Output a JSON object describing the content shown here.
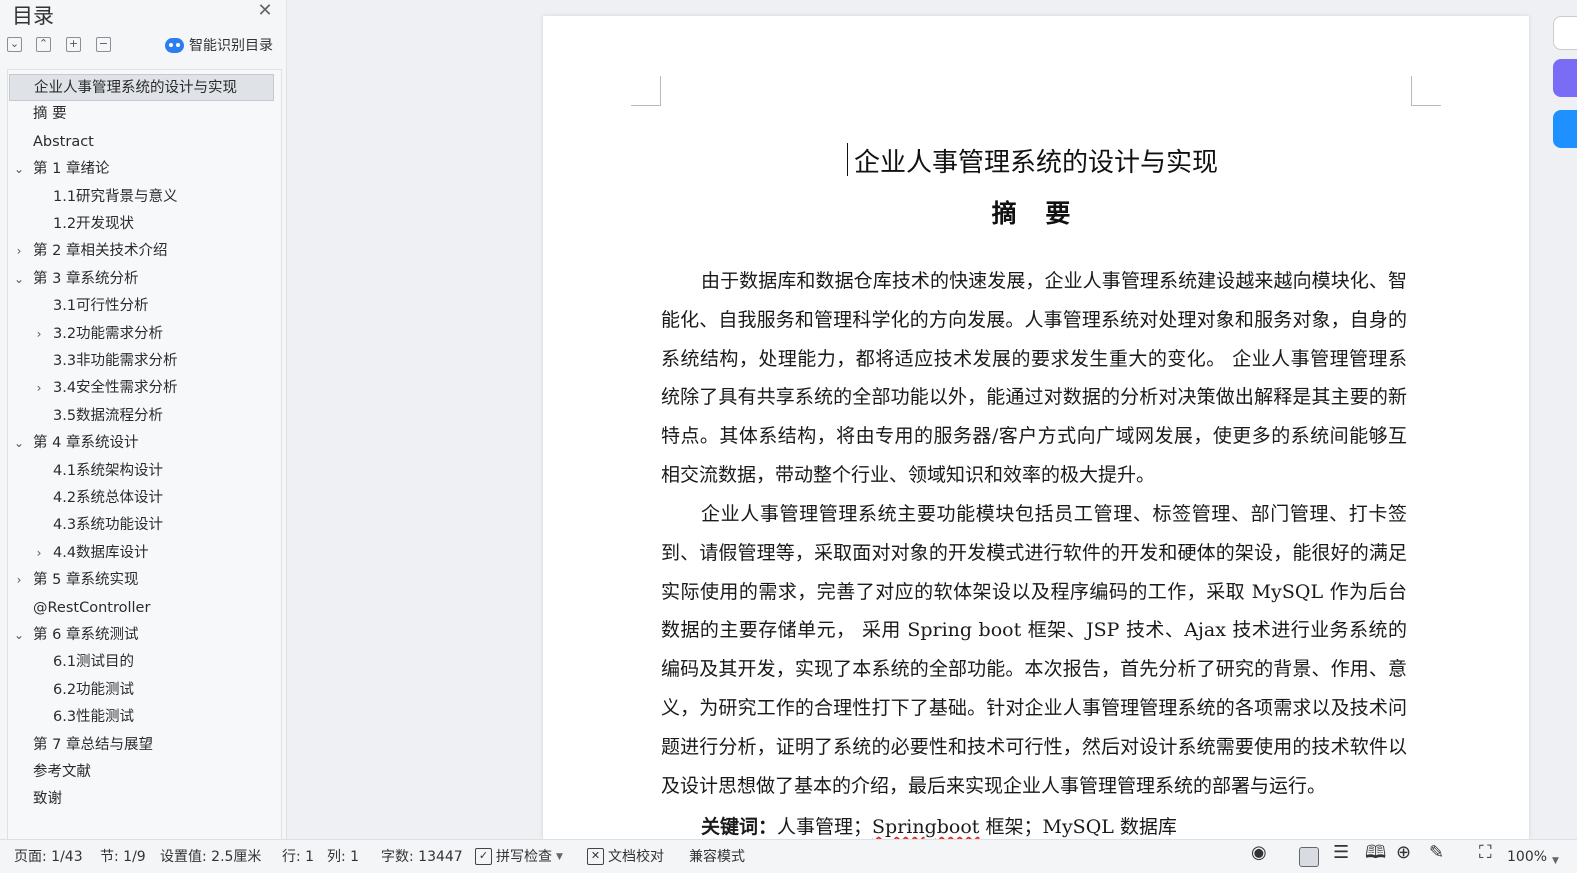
{
  "sidebar": {
    "title": "目录",
    "smart_toc_label": "智能识别目录",
    "toolbar_icons": [
      "expand-all-icon",
      "collapse-all-icon",
      "add-level-icon",
      "remove-level-icon"
    ],
    "items": [
      {
        "label": "企业人事管理系统的设计与实现",
        "active": true,
        "arrow": ""
      },
      {
        "label": "摘  要",
        "arrow": ""
      },
      {
        "label": "Abstract",
        "arrow": ""
      },
      {
        "label": "第 1 章绪论",
        "arrow": "open"
      },
      {
        "label": "1.1研究背景与意义",
        "arrow": ""
      },
      {
        "label": "1.2开发现状",
        "arrow": ""
      },
      {
        "label": "第 2 章相关技术介绍",
        "arrow": "closed"
      },
      {
        "label": "第 3 章系统分析",
        "arrow": "open"
      },
      {
        "label": "3.1可行性分析",
        "arrow": ""
      },
      {
        "label": "3.2功能需求分析",
        "arrow": "closed"
      },
      {
        "label": "3.3非功能需求分析",
        "arrow": ""
      },
      {
        "label": "3.4安全性需求分析",
        "arrow": "closed"
      },
      {
        "label": "3.5数据流程分析",
        "arrow": ""
      },
      {
        "label": "第 4 章系统设计",
        "arrow": "open"
      },
      {
        "label": "4.1系统架构设计",
        "arrow": ""
      },
      {
        "label": "4.2系统总体设计",
        "arrow": ""
      },
      {
        "label": "4.3系统功能设计",
        "arrow": ""
      },
      {
        "label": "4.4数据库设计",
        "arrow": "closed"
      },
      {
        "label": "第 5 章系统实现",
        "arrow": "closed"
      },
      {
        "label": "@RestController",
        "arrow": ""
      },
      {
        "label": "第 6 章系统测试",
        "arrow": "open"
      },
      {
        "label": "6.1测试目的",
        "arrow": ""
      },
      {
        "label": "6.2功能测试",
        "arrow": ""
      },
      {
        "label": "6.3性能测试",
        "arrow": ""
      },
      {
        "label": "第 7 章总结与展望",
        "arrow": ""
      },
      {
        "label": "参考文献",
        "arrow": ""
      },
      {
        "label": "致谢",
        "arrow": ""
      }
    ]
  },
  "document": {
    "title": "企业人事管理系统的设计与实现",
    "abstract_heading": "摘 要",
    "paragraph1": "由于数据库和数据仓库技术的快速发展，企业人事管理系统建设越来越向模块化、智能化、自我服务和管理科学化的方向发展。人事管理系统对处理对象和服务对象，自身的系统结构，处理能力，都将适应技术发展的要求发生重大的变化。 企业人事管理管理系统除了具有共享系统的全部功能以外，能通过对数据的分析对决策做出解释是其主要的新特点。其体系结构，将由专用的服务器/客户方式向广域网发展，使更多的系统间能够互相交流数据，带动整个行业、领域知识和效率的极大提升。",
    "paragraph2": "企业人事管理管理系统主要功能模块包括员工管理、标签管理、部门管理、打卡签到、请假管理等，采取面对对象的开发模式进行软件的开发和硬体的架设，能很好的满足实际使用的需求，完善了对应的软体架设以及程序编码的工作，采取 MySQL 作为后台数据的主要存储单元， 采用 Spring boot 框架、JSP 技术、Ajax 技术进行业务系统的编码及其开发，实现了本系统的全部功能。本次报告，首先分析了研究的背景、作用、意义，为研究工作的合理性打下了基础。针对企业人事管理管理系统的各项需求以及技术问题进行分析，证明了系统的必要性和技术可行性，然后对设计系统需要使用的技术软件以及设计思想做了基本的介绍，最后来实现企业人事管理管理系统的部署与运行。",
    "keywords_label": "关键词：",
    "keyword1": "人事管理；",
    "keyword2": "Springboot",
    "keyword3": " 框架；MySQL 数据库"
  },
  "statusbar": {
    "page": "页面: 1/43",
    "section": "节: 1/9",
    "setting": "设置值: 2.5厘米",
    "row": "行: 1",
    "col": "列: 1",
    "wordcount": "字数: 13447",
    "spellcheck": "拼写检查",
    "proofread": "文档校对",
    "compat": "兼容模式",
    "zoom": "100%"
  },
  "colors": {
    "accent": "#2e7df0",
    "edge_purple": "#7b6cf6",
    "edge_blue": "#1e90ff"
  }
}
